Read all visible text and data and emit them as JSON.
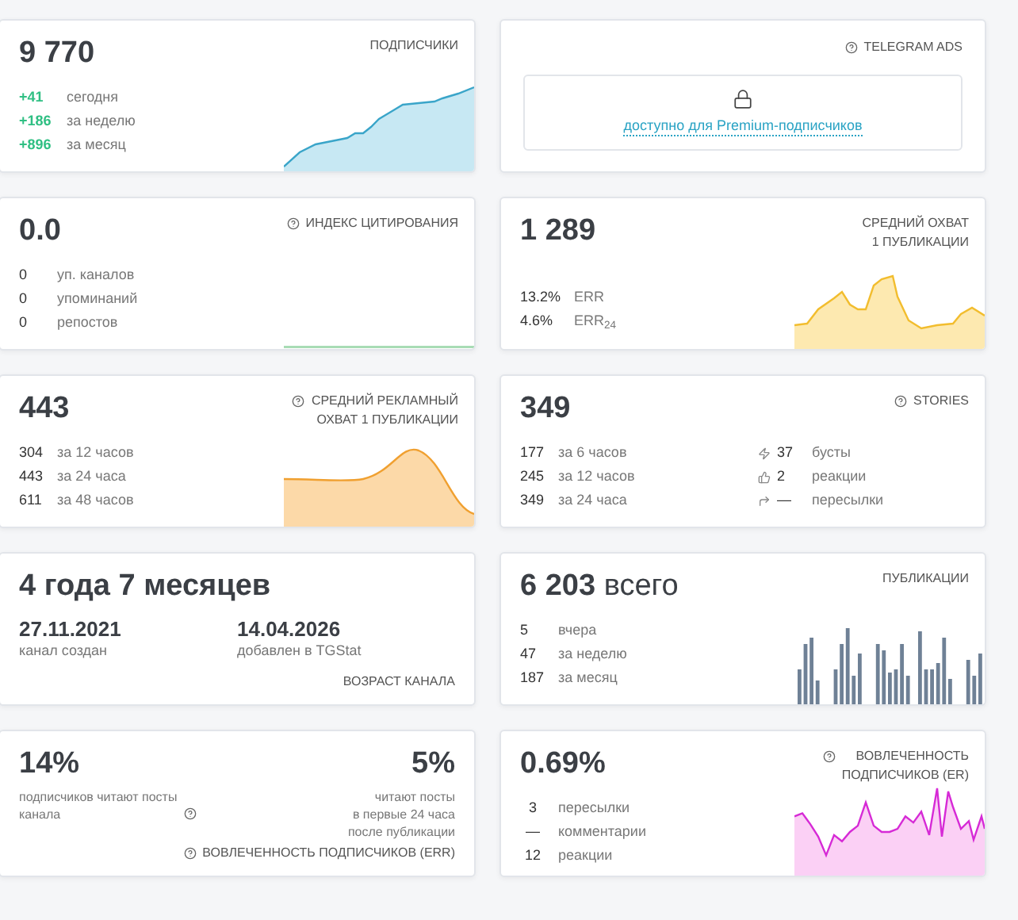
{
  "cards": [
    {
      "kind": "subscribers",
      "value": "9 770",
      "title": "ПОДПИСЧИКИ",
      "help": false,
      "rows": [
        {
          "value": "+41",
          "label": "сегодня"
        },
        {
          "value": "+186",
          "label": "за неделю"
        },
        {
          "value": "+896",
          "label": "за месяц"
        }
      ]
    },
    {
      "kind": "locked",
      "title": "TELEGRAM ADS",
      "help": true,
      "link": "доступно для Premium-подписчиков"
    },
    {
      "kind": "citation",
      "value": "0.0",
      "title": "ИНДЕКС ЦИТИРОВАНИЯ",
      "help": true,
      "rows": [
        {
          "value": "0",
          "label": "уп. каналов"
        },
        {
          "value": "0",
          "label": "упоминаний"
        },
        {
          "value": "0",
          "label": "репостов"
        }
      ]
    },
    {
      "kind": "reach",
      "value": "1 289",
      "title": "СРЕДНИЙ ОХВАТ\n1 ПУБЛИКАЦИИ",
      "help": false,
      "rows": [
        {
          "value": "13.2%",
          "label": "ERR"
        },
        {
          "value": "4.6%",
          "label": "ERR$_{24}$"
        }
      ]
    },
    {
      "kind": "ad_reach",
      "value": "443",
      "title": "СРЕДНИЙ РЕКЛАМНЫЙ\nОХВАТ 1 ПУБЛИКАЦИИ",
      "help": true,
      "rows": [
        {
          "value": "304",
          "label": "за 12 часов"
        },
        {
          "value": "443",
          "label": "за 24 часа"
        },
        {
          "value": "611",
          "label": "за 48 часов"
        }
      ]
    },
    {
      "kind": "stories",
      "value": "349",
      "title": "STORIES",
      "help": true,
      "rows": [
        {
          "value": "177",
          "label": "за 6 часов"
        },
        {
          "value": "245",
          "label": "за 12 часов"
        },
        {
          "value": "349",
          "label": "за 24 часа"
        }
      ],
      "extras": [
        {
          "kind": "boosts",
          "value": "37",
          "label": "бусты"
        },
        {
          "kind": "reactions",
          "value": "2",
          "label": "реакции"
        },
        {
          "kind": "forwards",
          "value": "—",
          "label": "пересылки"
        }
      ]
    },
    {
      "kind": "age",
      "value": "4 года 7 месяцев",
      "title": "ВОЗРАСТ КАНАЛА",
      "help": false,
      "dates": [
        {
          "value": "27.11.2021",
          "label": "канал создан"
        },
        {
          "value": "14.04.2026",
          "label": "добавлен в TGStat"
        }
      ]
    },
    {
      "kind": "posts",
      "value": "6 203",
      "suffix": "всего",
      "title": "ПУБЛИКАЦИИ",
      "help": false,
      "rows": [
        {
          "value": "5",
          "label": "вчера"
        },
        {
          "value": "47",
          "label": "за неделю"
        },
        {
          "value": "187",
          "label": "за месяц"
        }
      ]
    },
    {
      "kind": "err",
      "title": "ВОВЛЕЧЕННОСТЬ ПОДПИСЧИКОВ (ERR)",
      "help": true,
      "values": [
        {
          "value": "14%",
          "caption": "подписчиков читают посты\nканала",
          "help": true
        },
        {
          "value": "5%",
          "caption": "читают посты\nв первые 24 часа\nпосле публикации",
          "help": false
        }
      ]
    },
    {
      "kind": "er",
      "value": "0.69%",
      "title": "ВОВЛЕЧЕННОСТЬ\nПОДПИСЧИКОВ (ER)",
      "help": true,
      "rows": [
        {
          "value": "3",
          "label": "пересылки"
        },
        {
          "value": "—",
          "label": "комментарии"
        },
        {
          "value": "12",
          "label": "реакции"
        }
      ]
    }
  ]
}
